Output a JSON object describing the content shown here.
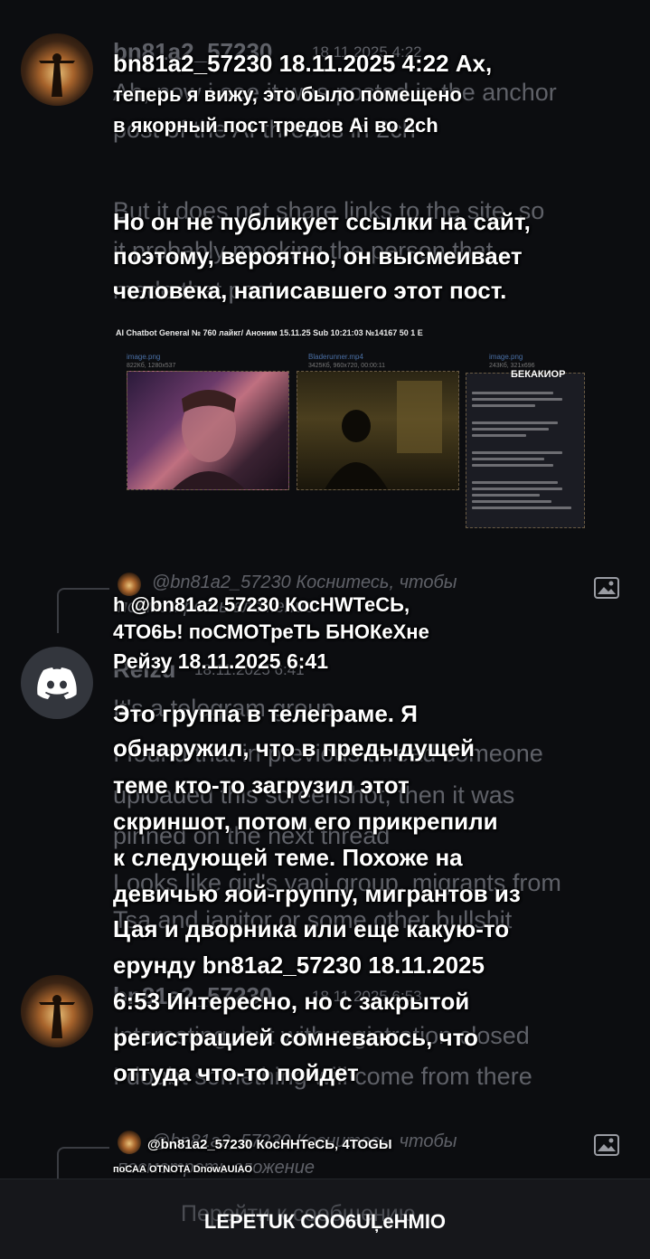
{
  "message1": {
    "ghost_header": "bn81a2_57230",
    "ghost_header_date": "18.11.2025 4:22",
    "ghost_line1": "Ah, now i see it was posted in the anchor",
    "ghost_line2": "post of the AI threads in 2ch",
    "translated_header": "bn81a2_57230 18.11.2025 4:22 Ах,",
    "translated_line2": "теперь я вижу, это было помещено",
    "translated_line3": "в якорный пост тредов Ai во 2ch",
    "ghost_para2_l1": "But it does not share links to the site, so",
    "ghost_para2_l2": "it probably mocking the person that",
    "ghost_para2_l3": "made that post.",
    "translated_para2_l1": "Но он не публикует ссылки на сайт,",
    "translated_para2_l2": "поэтому, вероятно, он высмеивает",
    "translated_para2_l3": "человека, написавшего этот пост."
  },
  "embedded_image": {
    "header": "AI Chatbot General № 760 лайкг/ Аноним 15.11.25 Sub 10:21:03 №14167 50 1 Е",
    "file1": "image.png",
    "file1_meta": "822Кб, 1280x537",
    "file2": "Bladerunner.mp4",
    "file2_meta": "3425Кб, 960x720, 00:00:11",
    "file3": "image.png",
    "file3_meta": "243Кб, 321x696",
    "overlay_label": "БЕКАКИОР"
  },
  "reply1": {
    "ghost_text": "@bn81a2_57230 Коснитесь, чтобы",
    "ghost_text2": "посмотреть вложение",
    "translated_l1": "h @bn81a2 57230 КосНWТеСЬ,",
    "translated_l2": "4ТО6Ь! поСМОТреТЬ БНОКеХне"
  },
  "message2": {
    "ghost_author": "Reizu",
    "ghost_date": "18.11.2025 6:41",
    "translated_header": "Рейзу 18.11.2025 6:41",
    "ghost_lines": [
      "It's a telegram group.",
      "I found that in previous thread someone",
      "uploaded this screenshot, then it was",
      "pinned on the next thread",
      "Looks like girl's yaoi group, migrants from",
      "Tsa and janitor or some other bullshit"
    ],
    "translated_lines": [
      "Это группа в телеграме. Я",
      "обнаружил, что в предыдущей",
      "теме кто-то загрузил этот",
      "скриншот, потом его прикрепили",
      "к следующей теме. Похоже на",
      "девичью яой-группу, мигрантов из",
      "Цая и дворника или еще какую-то",
      "ерунду bn81a2_57230 18.11.2025",
      "6:53 Интересно, но с закрытой",
      "регистрацией сомневаюсь, что",
      "оттуда что-то пойдет"
    ]
  },
  "message3": {
    "ghost_header": "bn81a2_57230",
    "ghost_date": "18.11.2025 6:53",
    "ghost_line1": "Interesting, but with registration closed",
    "ghost_line2": "I doubt something will come from there"
  },
  "reply2": {
    "ghost_text": "@bn81a2_57230 Коснитесь, чтобы",
    "ghost_text2": "посмотреть вложение",
    "translated_l1": "@bn81a2_57230 КосННТеСЬ, 4ТОGЫ",
    "translated_l2": "поСАА ОТNОТА DnowAUIАО"
  },
  "bottom": {
    "ghost_text": "Перейти к сообщению",
    "translated_text": "LЕРЕТUК СОО6UĻеНМIО"
  }
}
